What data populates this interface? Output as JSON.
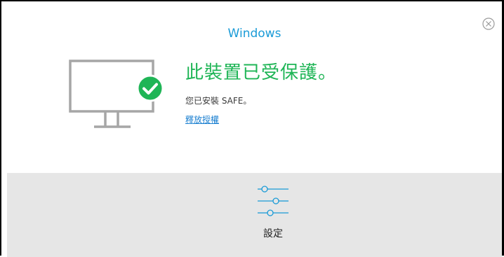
{
  "window": {
    "title": "Windows"
  },
  "status": {
    "headline": "此裝置已受保護。",
    "subtitle": "您已安裝 SAFE。",
    "release_link": "釋放授權"
  },
  "settings": {
    "label": "設定"
  },
  "icons": {
    "close": "close-circle-icon",
    "monitor": "monitor-icon",
    "check": "checkmark-badge-icon",
    "settings": "sliders-icon"
  },
  "colors": {
    "accent_blue": "#1a9bd7",
    "status_green": "#1fb556",
    "link_blue": "#1a7fd0",
    "panel_gray": "#e6e6e6",
    "monitor_gray": "#a6a6a6"
  }
}
